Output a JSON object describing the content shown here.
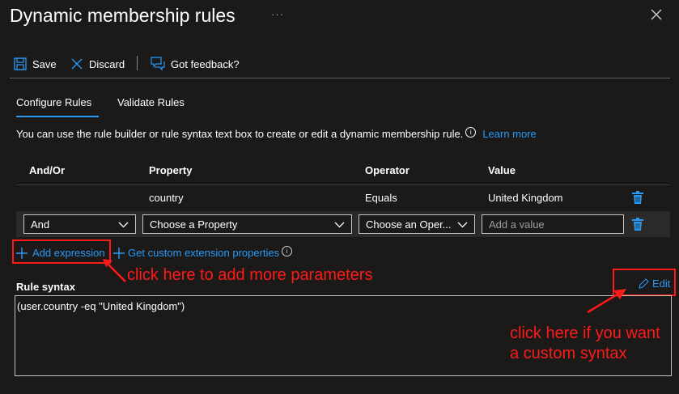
{
  "header": {
    "title": "Dynamic membership rules",
    "more": "···"
  },
  "toolbar": {
    "save": "Save",
    "discard": "Discard",
    "feedback": "Got feedback?"
  },
  "tabs": [
    {
      "label": "Configure Rules",
      "active": true
    },
    {
      "label": "Validate Rules",
      "active": false
    }
  ],
  "description": {
    "text": "You can use the rule builder or rule syntax text box to create or edit a dynamic membership rule.",
    "learn_more": "Learn more"
  },
  "table": {
    "columns": [
      "And/Or",
      "Property",
      "Operator",
      "Value"
    ],
    "rows": [
      {
        "andor": "",
        "property": "country",
        "operator": "Equals",
        "value": "United Kingdom"
      }
    ],
    "new_row": {
      "andor": "And",
      "property_placeholder": "Choose a Property",
      "operator_placeholder": "Choose an Oper...",
      "value_placeholder": "Add a value"
    }
  },
  "actions": {
    "add_expression": "Add expression",
    "custom_ext": "Get custom extension properties"
  },
  "rule_syntax": {
    "label": "Rule syntax",
    "edit": "Edit",
    "value": "(user.country -eq \"United Kingdom\")"
  },
  "annotations": {
    "add_params": "click here to add more parameters",
    "custom_line1": "click here if you want",
    "custom_line2": "a custom syntax"
  },
  "colors": {
    "background": "#1b1a19",
    "accent": "#2899f5",
    "annotation": "#ff1a1a"
  }
}
